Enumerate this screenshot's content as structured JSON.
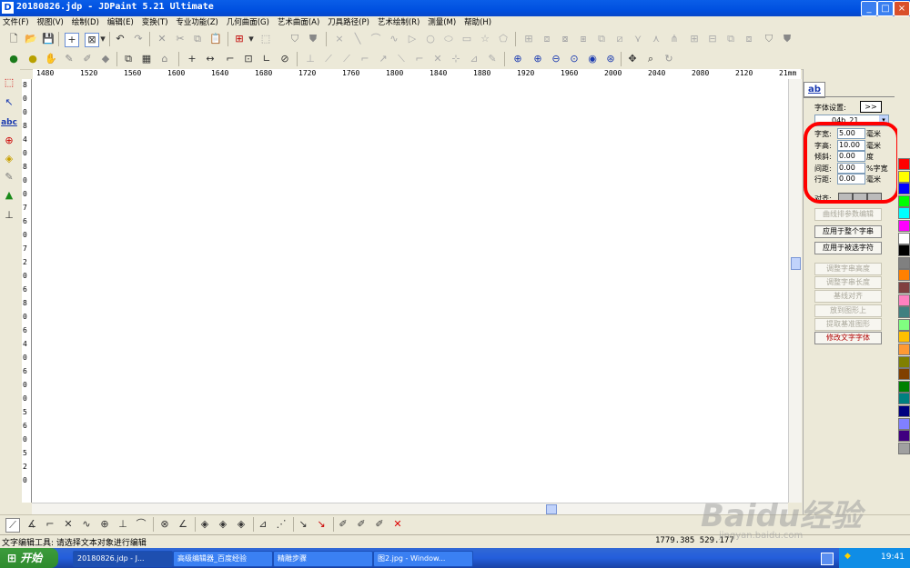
{
  "window": {
    "title": "20180826.jdp - JDPaint 5.21 Ultimate",
    "app_icon": "D",
    "controls": {
      "minimize": "_",
      "maximize": "□",
      "close": "×"
    }
  },
  "menu": [
    "文件(F)",
    "视图(V)",
    "绘制(D)",
    "编辑(E)",
    "变换(T)",
    "专业功能(Z)",
    "几何曲面(G)",
    "艺术曲面(A)",
    "刀具路径(P)",
    "艺术绘制(R)",
    "测量(M)",
    "帮助(H)"
  ],
  "ruler": {
    "top_labels": [
      "1480",
      "1520",
      "1560",
      "1600",
      "1640",
      "1680",
      "1720",
      "1760",
      "1800",
      "1840",
      "1880",
      "1920",
      "1960",
      "2000",
      "2040",
      "2080",
      "2120",
      "21mm"
    ],
    "left_labels": [
      "8",
      "0",
      "0",
      "8",
      "4",
      "0",
      "8",
      "0",
      "0",
      "7",
      "6",
      "0",
      "7",
      "2",
      "0",
      "6",
      "8",
      "0",
      "6",
      "4",
      "0",
      "6",
      "0",
      "0",
      "5",
      "6",
      "0",
      "5",
      "2",
      "0"
    ]
  },
  "panel": {
    "tab_label": "ab",
    "font_settings_label": "字体设置:",
    "font_settings_button": ">>",
    "font_name": "04b_21",
    "fields": [
      {
        "label": "字宽:",
        "value": "5.00",
        "unit": "毫米"
      },
      {
        "label": "字高:",
        "value": "10.00",
        "unit": "毫米"
      },
      {
        "label": "倾斜:",
        "value": "0.00",
        "unit": "度"
      },
      {
        "label": "间距:",
        "value": "0.00",
        "unit": "%字宽"
      },
      {
        "label": "行距:",
        "value": "0.00",
        "unit": "毫米"
      }
    ],
    "align_label": "对齐:",
    "buttons": [
      {
        "label": "曲线排参数编辑",
        "state": "disabled"
      },
      {
        "label": "应用于整个字串",
        "state": "normal"
      },
      {
        "label": "应用于被选字符",
        "state": "normal"
      },
      {
        "label": "调整字串高度",
        "state": "disabled"
      },
      {
        "label": "调整字串长度",
        "state": "disabled"
      },
      {
        "label": "基线对齐",
        "state": "disabled"
      },
      {
        "label": "放到图形上",
        "state": "disabled"
      },
      {
        "label": "提取基准图形",
        "state": "disabled"
      },
      {
        "label": "修改文字字体",
        "state": "red"
      }
    ],
    "highlight_color": "#ff0000"
  },
  "palette": [
    "#ff0000",
    "#ffff00",
    "#0000ff",
    "#00ff00",
    "#00ffff",
    "#ff00ff",
    "#ffffff",
    "#000000",
    "#808080",
    "#ff8000",
    "#804040",
    "#ff80c0",
    "#408080",
    "#80ff80",
    "#ffc000",
    "#ff9933",
    "#808000",
    "#804000",
    "#008000",
    "#008080",
    "#000080",
    "#8080ff",
    "#400080",
    "#a0a0a0"
  ],
  "status": {
    "message": "文字编辑工具: 请选择文本对象进行编辑",
    "coordinates": "1779.385  529.177"
  },
  "taskbar": {
    "start": "开始",
    "tasks": [
      {
        "label": "20180826.jdp - J...",
        "active": true
      },
      {
        "label": "高级编辑器_百度经验",
        "active": false
      },
      {
        "label": "精雕步骤",
        "active": false
      },
      {
        "label": "图2.jpg - Window...",
        "active": false
      }
    ],
    "clock": "19:41"
  },
  "watermark": {
    "text": "Baidu经验",
    "sub": "jingyan.baidu.com"
  }
}
